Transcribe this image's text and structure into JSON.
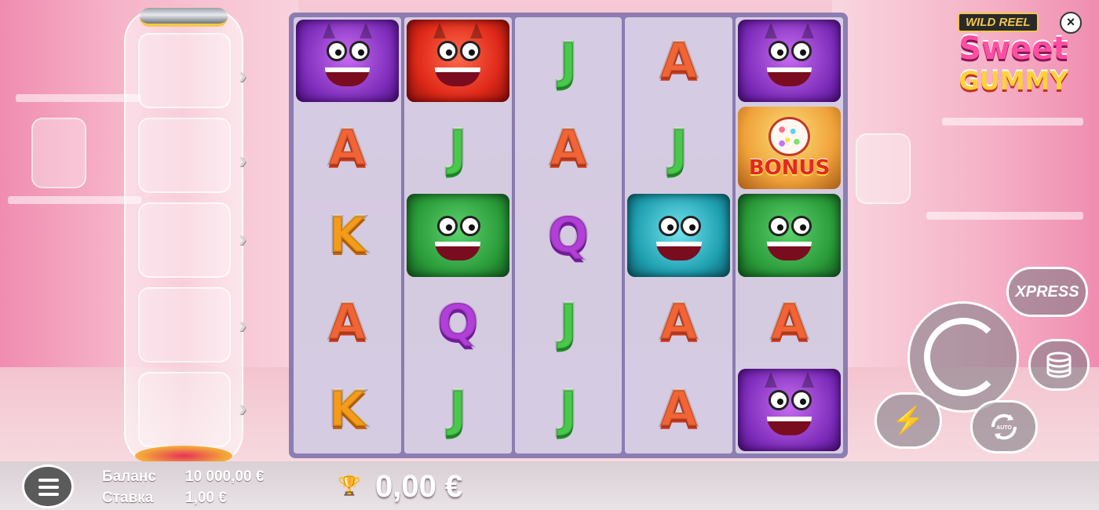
{
  "logo": {
    "badge": "WILD REEL",
    "title": "Sweet",
    "subtitle": "GUMMY"
  },
  "close_label": "×",
  "xpress_label": "XPRESS",
  "auto_label": "AUTO",
  "turbo_icon": "lightning-icon",
  "bonus_label": "BONUS",
  "reels": [
    [
      {
        "s": "purple"
      },
      {
        "s": "A"
      },
      {
        "s": "K"
      },
      {
        "s": "A"
      },
      {
        "s": "K"
      }
    ],
    [
      {
        "s": "red"
      },
      {
        "s": "J"
      },
      {
        "s": "green"
      },
      {
        "s": "Q"
      },
      {
        "s": "J"
      }
    ],
    [
      {
        "s": "J"
      },
      {
        "s": "A"
      },
      {
        "s": "Q"
      },
      {
        "s": "J"
      },
      {
        "s": "J"
      }
    ],
    [
      {
        "s": "A"
      },
      {
        "s": "J"
      },
      {
        "s": "teal"
      },
      {
        "s": "A"
      },
      {
        "s": "A"
      }
    ],
    [
      {
        "s": "purple"
      },
      {
        "s": "bonus"
      },
      {
        "s": "green"
      },
      {
        "s": "A"
      },
      {
        "s": "purple"
      }
    ]
  ],
  "footer": {
    "balance_label": "Баланс",
    "balance_value": "10 000,00 €",
    "bet_label": "Ставка",
    "bet_value": "1,00 €",
    "win_value": "0,00 €"
  },
  "colors": {
    "accent_pink": "#ff4fa3",
    "frame": "#786eaa",
    "letter_A": "#f26436",
    "letter_J": "#49c94c",
    "letter_K": "#f59b1a",
    "letter_Q": "#b23fd8"
  }
}
